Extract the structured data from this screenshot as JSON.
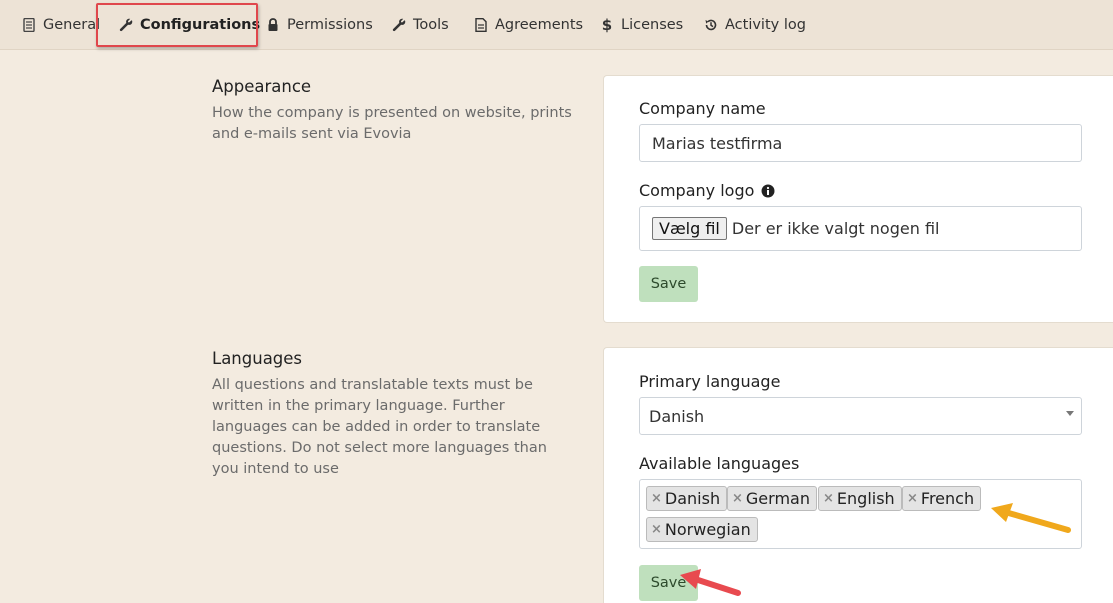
{
  "tabs": [
    {
      "label": "General",
      "icon": "document-icon"
    },
    {
      "label": "Configurations",
      "icon": "wrench-icon",
      "active": true
    },
    {
      "label": "Permissions",
      "icon": "lock-icon"
    },
    {
      "label": "Tools",
      "icon": "wrench-icon"
    },
    {
      "label": "Agreements",
      "icon": "file-text-icon"
    },
    {
      "label": "Licenses",
      "icon": "dollar-icon"
    },
    {
      "label": "Activity log",
      "icon": "history-icon"
    }
  ],
  "appearance": {
    "title": "Appearance",
    "description": "How the company is presented on website, prints and e-mails sent via Evovia",
    "company_name_label": "Company name",
    "company_name_value": "Marias testfirma",
    "company_logo_label": "Company logo",
    "file_button_label": "Vælg fil",
    "file_status": "Der er ikke valgt nogen fil",
    "save_label": "Save"
  },
  "languages": {
    "title": "Languages",
    "description": "All questions and translatable texts must be written in the primary language. Further languages can be added in order to translate questions. Do not select more languages than you intend to use",
    "primary_label": "Primary language",
    "primary_value": "Danish",
    "available_label": "Available languages",
    "available": [
      "Danish",
      "German",
      "English",
      "French",
      "Norwegian"
    ],
    "save_label": "Save"
  },
  "colors": {
    "page_bg": "#f3ebe0",
    "save_button": "#bfe0bd",
    "highlight": "#e0474c",
    "annotation_arrow_orange": "#f0a81c",
    "annotation_arrow_red": "#e84a4f"
  }
}
